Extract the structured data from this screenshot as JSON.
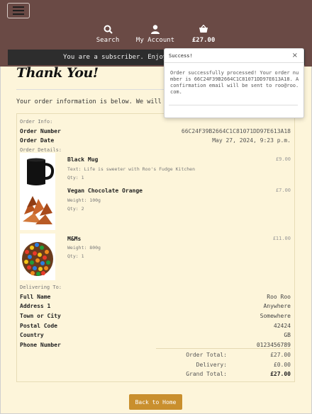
{
  "header": {
    "nav": {
      "search_label": "Search",
      "account_label": "My Account",
      "bag_total": "£27.00"
    },
    "banner_text": "You are a subscriber. Enjoy y"
  },
  "toast": {
    "title": "Success!",
    "close": "×",
    "message": "Order successfully processed! Your order number is 66C24F39B2664C1C81071DD97E613A18. A confirmation email will be sent to roo@roo.com."
  },
  "page": {
    "title": "Thank You!",
    "intro": "Your order information is below. We will s"
  },
  "order_info": {
    "heading": "Order Info:",
    "number_label": "Order Number",
    "number_value": "66C24F39B2664C1C81071DD97E613A18",
    "date_label": "Order Date",
    "date_value": "May 27, 2024, 9:23 p.m."
  },
  "order_details": {
    "heading": "Order Details:",
    "items": [
      {
        "name": "Black Mug",
        "meta1": "Text: Life is sweeter with Roo's Fudge Kitchen",
        "meta2": "Qty: 1",
        "price": "£9.00",
        "image": "black-mug"
      },
      {
        "name": "Vegan Chocolate Orange",
        "meta1": "Weight: 100g",
        "meta2": "Qty: 2",
        "price": "£7.00",
        "image": "chocolate-orange"
      },
      {
        "name": "M&Ms",
        "meta1": "Weight: 800g",
        "meta2": "Qty: 1",
        "price": "£11.00",
        "image": "mms"
      }
    ]
  },
  "delivery": {
    "heading": "Delivering To:",
    "rows": [
      {
        "label": "Full Name",
        "value": "Roo Roo"
      },
      {
        "label": "Address 1",
        "value": "Anywhere"
      },
      {
        "label": "Town or City",
        "value": "Somewhere"
      },
      {
        "label": "Postal Code",
        "value": "42424"
      },
      {
        "label": "Country",
        "value": "GB"
      },
      {
        "label": "Phone Number",
        "value": "0123456789"
      }
    ]
  },
  "totals": {
    "order_total_label": "Order Total:",
    "order_total": "£27.00",
    "delivery_label": "Delivery:",
    "delivery": "£0.00",
    "grand_total_label": "Grand Total:",
    "grand_total": "£27.00"
  },
  "back_button": "Back to Home",
  "colors": {
    "header_bg": "#6a4a45",
    "page_bg": "#fdf5da",
    "button_bg": "#c98f2e",
    "banner_bg": "#2d2d2d"
  }
}
